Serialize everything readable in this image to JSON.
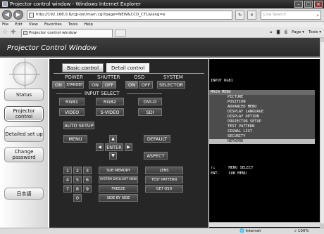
{
  "browser": {
    "window_title": "Projector control window - Windows Internet Explorer",
    "url": "http://192.168.0.8/cgi-bin/main.cgi?page=NEW&CCD_CTL&lang=e",
    "search_placeholder": "Live Search",
    "menu": [
      "File",
      "Edit",
      "View",
      "Favorites",
      "Tools",
      "Help"
    ],
    "tab_title": "Projector control window",
    "toolbar_right": [
      "Page ▾",
      "Tools ▾"
    ],
    "status_zone": "Internet",
    "status_zoom": "100%"
  },
  "page": {
    "title": "Projector Control Window",
    "nav": [
      {
        "label": "Status"
      },
      {
        "label": "Projector control"
      },
      {
        "label": "Detailed set up"
      },
      {
        "label": "Change password"
      },
      {
        "label": "日本語"
      }
    ],
    "tabs": [
      "Basic control",
      "Detail control"
    ],
    "selected_tab": "Detail control"
  },
  "controls": {
    "power_label": "POWER",
    "shutter_label": "SHUTTER",
    "osd_label": "OSD",
    "system_label": "SYSTEM",
    "power_on": "ON",
    "power_standby": "STANDBY",
    "shutter_on": "ON",
    "shutter_off": "OFF",
    "osd_on": "ON",
    "osd_off": "OFF",
    "system_selector": "SELECTOR",
    "input_select_label": "INPUT SELECT",
    "inputs": [
      "RGB1",
      "RGB2",
      "DVI-D",
      "VIDEO",
      "S-VIDEO",
      "SDI"
    ],
    "auto_setup": "AUTO SETUP",
    "menu": "MENU",
    "default": "DEFAULT",
    "enter": "ENTER",
    "aspect": "ASPECT",
    "numbers": [
      "1",
      "2",
      "3",
      "4",
      "5",
      "6",
      "7",
      "8",
      "9",
      "0"
    ],
    "sub_memory": "SUB MEMORY",
    "lens": "LENS",
    "system_daylight_view": "SYSTEM DAYLIGHT VIEW",
    "test_pattern": "TEST PATTERN",
    "freeze": "FREEZE",
    "get_osd": "GET OSD",
    "side_by_side": "SIDE BY SIDE"
  },
  "osd": {
    "input": "INPUT RGB1",
    "main_menu": "MAIN MENU",
    "items": [
      "PICTURE",
      "POSITION",
      "ADVANCED MENU",
      "DISPLAY LANGUAGE",
      "DISPLAY OPTION",
      "PROJECTOR SETUP",
      "TEST PATTERN",
      "SIGNAL LIST",
      "SECURITY",
      "NETWORK"
    ],
    "highlighted": "NETWORK",
    "help_line1": "↑↓      MENU SELECT",
    "help_line2": "ENT.    SUB MENU"
  }
}
